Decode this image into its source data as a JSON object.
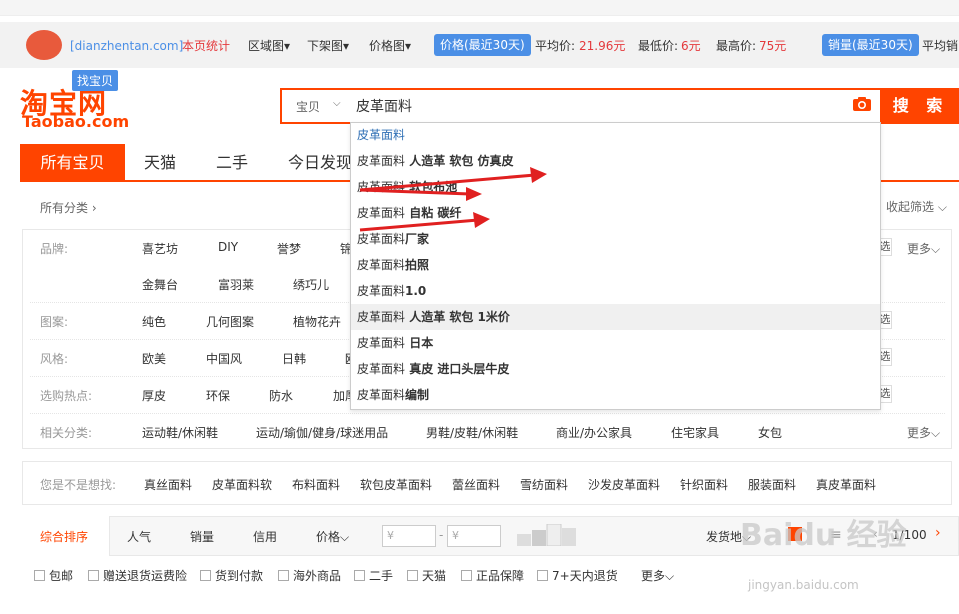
{
  "toolbar": {
    "site": "[dianzhentan.com]",
    "stats": "本页统计",
    "region": "区域图",
    "delist": "下架图",
    "price_chart": "价格图",
    "price_pill": "价格(最近30天)",
    "avg_label": "平均价:",
    "avg_value": "21.96元",
    "min_label": "最低价:",
    "min_value": "6元",
    "max_label": "最高价:",
    "max_value": "75元",
    "sales_pill": "销量(最近30天)",
    "sales_avg": "平均销"
  },
  "header": {
    "logo_cn": "淘宝网",
    "logo_en": "Taobao.com",
    "find_tag": "找宝贝",
    "scope": "宝贝",
    "query": "皮革面料",
    "search_button": "搜 索"
  },
  "tabs": [
    "所有宝贝",
    "天猫",
    "二手",
    "今日发现"
  ],
  "crumb": "所有分类",
  "collapse": "收起筛选",
  "filters": {
    "brand_label": "品牌:",
    "brand_items": [
      "喜艺坊",
      "DIY",
      "誉梦",
      "锦"
    ],
    "brand_items2": [
      "金舞台",
      "富羽莱",
      "绣巧儿"
    ],
    "pattern_label": "图案:",
    "pattern_items": [
      "纯色",
      "几何图案",
      "植物花卉"
    ],
    "style_label": "风格:",
    "style_items": [
      "欧美",
      "中国风",
      "日韩",
      "欧"
    ],
    "hot_label": "选购热点:",
    "hot_items": [
      "厚皮",
      "环保",
      "防水",
      "加厚"
    ],
    "related_label": "相关分类:",
    "related_items": [
      "运动鞋/休闲鞋",
      "运动/瑜伽/健身/球迷用品",
      "男鞋/皮鞋/休闲鞋",
      "商业/办公家具",
      "住宅家具",
      "女包"
    ],
    "more": "更多",
    "multi": "选"
  },
  "suggestions": [
    {
      "prefix": "皮革面料",
      "bold": ""
    },
    {
      "prefix": "皮革面料",
      "bold": " 人造革 软包 仿真皮"
    },
    {
      "prefix": "皮革面料",
      "bold": " 软包布池"
    },
    {
      "prefix": "皮革面料",
      "bold": " 自粘 碳纤"
    },
    {
      "prefix": "皮革面料",
      "bold": "厂家"
    },
    {
      "prefix": "皮革面料",
      "bold": "拍照"
    },
    {
      "prefix": "皮革面料",
      "bold": "1.0"
    },
    {
      "prefix": "皮革面料",
      "bold": " 人造革 软包 1米价"
    },
    {
      "prefix": "皮革面料",
      "bold": " 日本"
    },
    {
      "prefix": "皮革面料",
      "bold": " 真皮 进口头层牛皮"
    },
    {
      "prefix": "皮革面料",
      "bold": "编制"
    }
  ],
  "didyou": {
    "label": "您是不是想找:",
    "items": [
      "真丝面料",
      "皮革面料软",
      "布料面料",
      "软包皮革面料",
      "蕾丝面料",
      "雪纺面料",
      "沙发皮革面料",
      "针织面料",
      "服装面料",
      "真皮革面料"
    ]
  },
  "sortbar": {
    "items": [
      "综合排序",
      "人气",
      "销量",
      "信用",
      "价格"
    ],
    "price_ph": "¥",
    "ship": "发货地",
    "page": "1/100"
  },
  "checks": [
    "包邮",
    "赠送退货运费险",
    "货到付款",
    "海外商品",
    "二手",
    "天猫",
    "正品保障",
    "7+天内退货"
  ],
  "checks_more": "更多",
  "watermark": "Baidu 经验",
  "watermark2": "jingyan.baidu.com"
}
